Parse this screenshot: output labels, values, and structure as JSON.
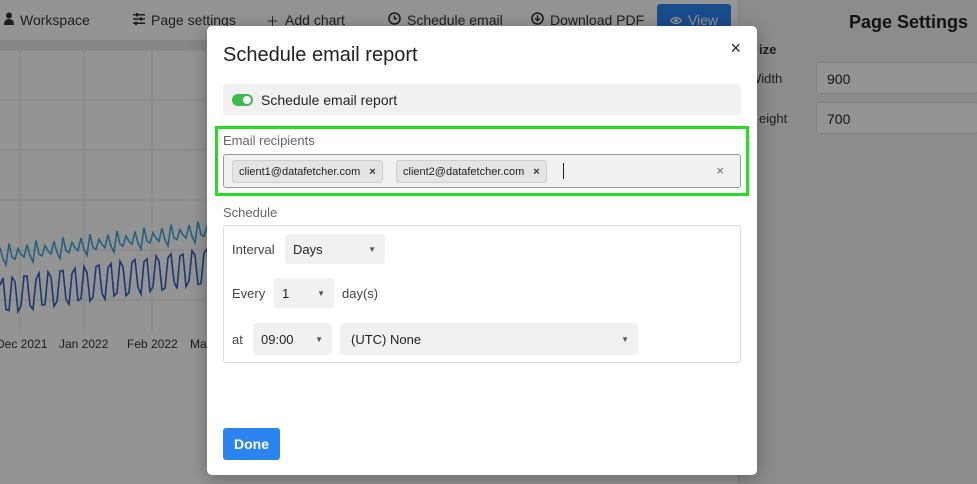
{
  "toolbar": {
    "workspace": "Workspace",
    "page_settings": "Page settings",
    "add_chart": "Add chart",
    "schedule_email": "Schedule email",
    "download_pdf": "Download PDF",
    "view": "View"
  },
  "chart": {
    "x_ticks": [
      "Dec 2021",
      "Jan 2022",
      "Feb 2022",
      "Mar"
    ],
    "colors": {
      "series_light": "#3fa7d6",
      "series_dark": "#2f5fc4"
    }
  },
  "right_panel": {
    "title": "Page Settings",
    "size_label": "ize",
    "width_label": "Width",
    "width_value": "900",
    "height_label": "eight",
    "height_value": "700"
  },
  "modal": {
    "title": "Schedule email report",
    "close": "×",
    "toggle_label": "Schedule email report",
    "toggle_on": true,
    "recipients_label": "Email recipients",
    "recipients": [
      "client1@datafetcher.com",
      "client2@datafetcher.com"
    ],
    "chip_remove": "×",
    "clear": "×",
    "schedule_label": "Schedule",
    "interval_label": "Interval",
    "interval_value": "Days",
    "every_label": "Every",
    "every_value": "1",
    "every_unit": "day(s)",
    "at_label": "at",
    "time_value": "09:00",
    "timezone_value": "(UTC) None",
    "done": "Done"
  },
  "colors": {
    "accent": "#2c84f0",
    "highlight": "#22e01f",
    "toggle": "#3fb950"
  }
}
